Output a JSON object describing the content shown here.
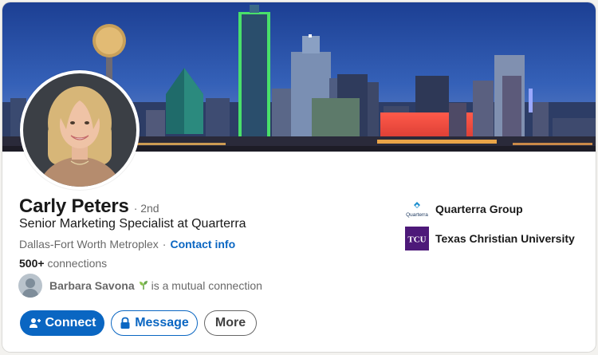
{
  "profile": {
    "name": "Carly Peters",
    "degree": "· 2nd",
    "headline": "Senior Marketing Specialist at Quarterra",
    "location": "Dallas-Fort Worth Metroplex",
    "separator": "·",
    "contact_info": "Contact info",
    "connections_count": "500+",
    "connections_label": "connections"
  },
  "mutual": {
    "name": "Barbara Savona",
    "suffix": "is a mutual connection"
  },
  "actions": {
    "connect": "Connect",
    "message": "Message",
    "more": "More"
  },
  "organizations": [
    {
      "name": "Quarterra Group",
      "logo_text": "Quarterra",
      "icon": "quarterra-logo"
    },
    {
      "name": "Texas Christian University",
      "logo_text": "TCU",
      "icon": "tcu-logo"
    }
  ],
  "colors": {
    "primary": "#0a66c2",
    "tcu_purple": "#4d1979"
  }
}
